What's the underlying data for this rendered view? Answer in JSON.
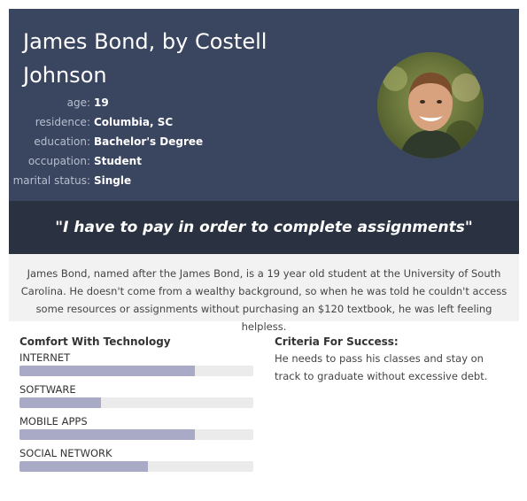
{
  "persona": {
    "name": "James Bond, by Costell John­son",
    "facts": [
      {
        "key": "age:",
        "value": "19"
      },
      {
        "key": "residence:",
        "value": "Columbia, SC"
      },
      {
        "key": "education:",
        "value": "Bachelor's Degree"
      },
      {
        "key": "occupation:",
        "value": "Student"
      },
      {
        "key": "marital status:",
        "value": "Single"
      }
    ],
    "quote": "\"I have to pay in order to complete assignments\"",
    "bio": "James Bond, named after the James Bond, is a 19 year old student at the University of South Carolina. He doesn't come from a wealthy background, so when he was told he couldn't access some resources or assignments without purchasing an $120 textbook, he was left feeling helpless."
  },
  "tech": {
    "title": "Comfort With Technology",
    "skills": [
      {
        "label": "INTERNET",
        "level": 0.75
      },
      {
        "label": "SOFTWARE",
        "level": 0.35
      },
      {
        "label": "MOBILE APPS",
        "level": 0.75
      },
      {
        "label": "SOCIAL NETWORK",
        "level": 0.55
      }
    ]
  },
  "criteria": {
    "title": "Criteria For Success:",
    "text": "He needs to pass his classes and stay on track to graduate without excessive debt."
  },
  "colors": {
    "header_bg": "#3a4560",
    "quote_bg": "#2a3140",
    "bar_fill": "#a9aac6",
    "bar_track": "#ebebeb"
  }
}
